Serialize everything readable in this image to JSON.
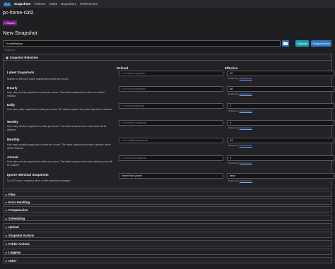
{
  "nav": {
    "items": [
      {
        "label": "Snapshots",
        "active": true
      },
      {
        "label": "Policies",
        "active": false
      },
      {
        "label": "Tasks",
        "active": false
      },
      {
        "label": "Repository",
        "active": false
      },
      {
        "label": "Preferences",
        "active": false
      }
    ],
    "logo_icon": "cloud-logo-icon"
  },
  "hostname": "pc-home-r2d2",
  "return_label": "< Return",
  "page_title": "New Snapshot",
  "path": {
    "value": "D:\\ws\\Backup",
    "folder_icon": "folder-icon"
  },
  "buttons": {
    "estimate": "Estimate",
    "snapshot_now": "Snapshot Now"
  },
  "settings_tab": "Snapshot",
  "retention": {
    "title": "Snapshot Retention",
    "col_defined": "Defined",
    "col_effective": "Effective",
    "defined_by_prefix": "Defined by",
    "defined_by_link": "Global Policy",
    "rows": [
      {
        "label": "Latest Snapshots",
        "help": "Number of the most recent snapshots to retain per source",
        "placeholder": "# of latest snapshots",
        "effective": "10"
      },
      {
        "label": "Hourly",
        "help": "How many hourly snapshots to retain per source. The latest snapshot from each hour will be retained",
        "placeholder": "# of hourly snapshots",
        "effective": "48"
      },
      {
        "label": "Daily",
        "help": "How many daily snapshots to retain per source. The latest snapshot from each day will be retained",
        "placeholder": "# of daily snapshots",
        "effective": "7"
      },
      {
        "label": "Weekly",
        "help": "How many weekly snapshots to retain per source. The latest snapshot from each week will be retained",
        "placeholder": "# of weekly snapshots",
        "effective": "4"
      },
      {
        "label": "Monthly",
        "help": "How many monthly snapshots to retain per source. The latest snapshot from each calendar month will be retained",
        "placeholder": "# of monthly snapshots",
        "effective": "24"
      },
      {
        "label": "Annual",
        "help": "How many annual snapshots to retain per source. The latest snapshot from each calendar year will be retained",
        "placeholder": "# of annual snapshots",
        "effective": "3"
      },
      {
        "label": "Ignore Identical Snapshots",
        "help": "Do NOT save a snapshot when no files have been changed",
        "placeholder": "inherit from parent",
        "effective": "false"
      }
    ]
  },
  "sections": [
    "Files",
    "Error Handling",
    "Compression",
    "Scheduling",
    "Upload",
    "Snapshot Actions",
    "Folder Actions",
    "Logging",
    "Other"
  ]
}
